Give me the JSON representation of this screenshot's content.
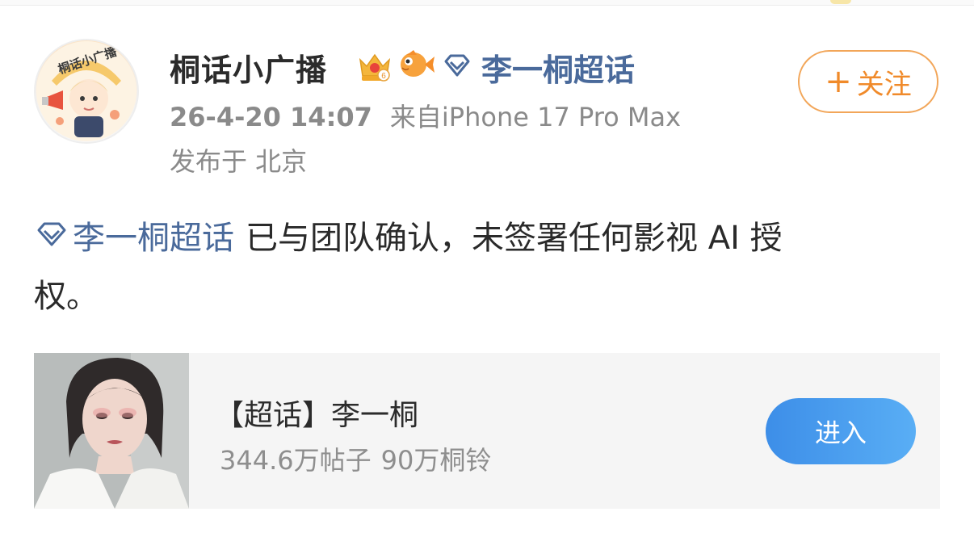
{
  "post": {
    "username": "桐话小广播",
    "topic_name": "李一桐超话",
    "time": "26-4-20 14:07",
    "source": "来自iPhone 17 Pro Max",
    "location": "发布于 北京",
    "follow_label": "关注",
    "follow_plus": "+",
    "avatar_text": "桐话小广播",
    "crown_level": "6",
    "body_text_line1": "已与团队确认，未签署任何影视 AI 授",
    "body_text_line2": "权。"
  },
  "card": {
    "title": "【超话】李一桐",
    "posts": "344.6万帖子",
    "members": "90万桐铃",
    "enter_label": "进入"
  },
  "icons": {
    "crown": "crown-level-badge-icon",
    "fish": "fish-badge-icon",
    "topic": "diamond-topic-icon"
  },
  "colors": {
    "topic_link": "#4a6a9b",
    "follow_orange": "#f08a2a",
    "enter_blue": "#3d8ee8",
    "meta_gray": "#8a8a8a"
  }
}
